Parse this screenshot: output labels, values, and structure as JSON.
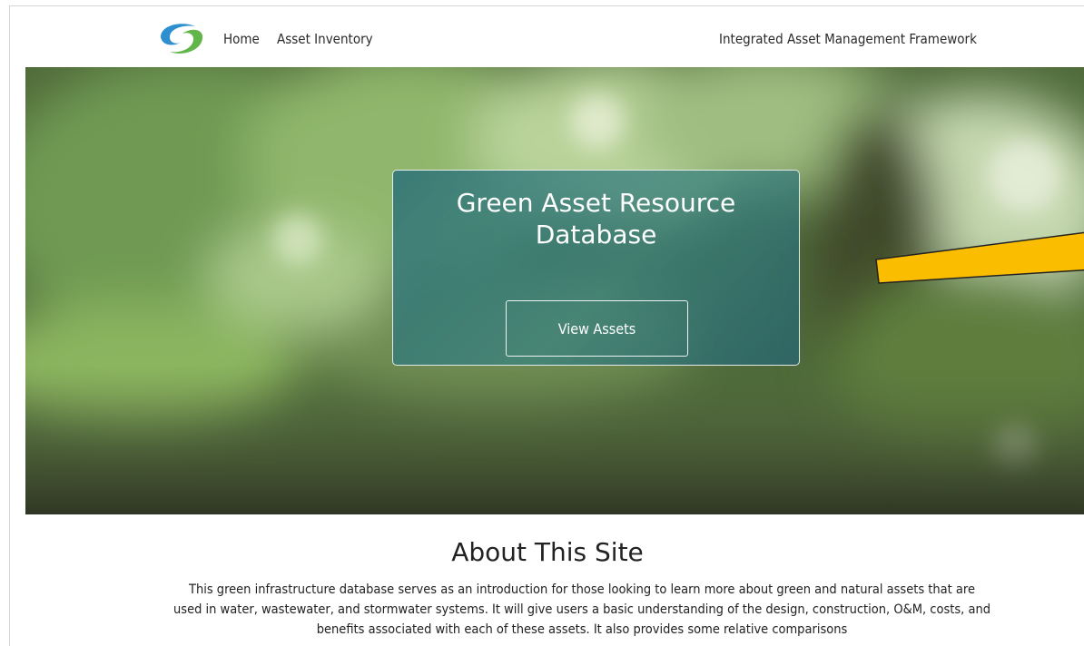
{
  "nav": {
    "home_label": "Home",
    "inventory_label": "Asset Inventory",
    "framework_label": "Integrated Asset Management Framework"
  },
  "hero": {
    "title": "Green Asset Resource Database",
    "button_label": "View Assets"
  },
  "about": {
    "title": "About This Site",
    "text": "This green infrastructure database serves as an introduction for those looking to learn more about green and natural assets that are used in water, wastewater, and stormwater systems. It will give users a basic understanding of the design, construction, O&M, costs, and benefits associated with each of these assets. It also provides some relative comparisons"
  },
  "colors": {
    "arrow_fill": "#fbbd00",
    "card_tint": "#2f7c84"
  },
  "icons": {
    "logo": "swirl-logo-icon",
    "annotation": "yellow-arrow-icon"
  }
}
